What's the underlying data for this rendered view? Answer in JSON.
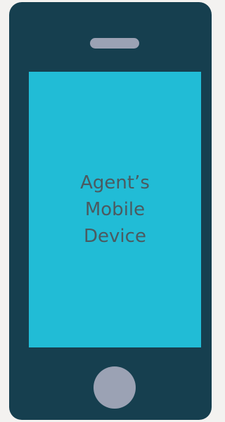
{
  "device": {
    "screen_label": "Agent’s\nMobile\nDevice",
    "colors": {
      "body": "#163f4f",
      "screen": "#21bcd6",
      "controls": "#9ba2b4",
      "label_text": "#4b5a60"
    }
  }
}
